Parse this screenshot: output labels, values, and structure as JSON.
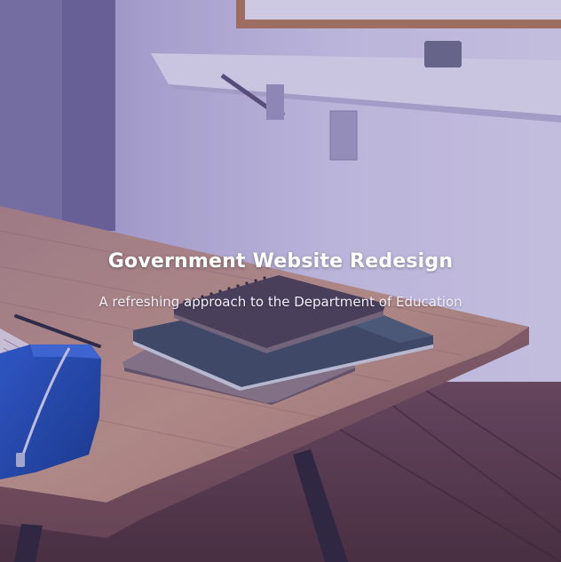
{
  "hero": {
    "title": "Government Website Redesign",
    "subtitle": "A refreshing approach to the Department of Education"
  },
  "colors": {
    "overlay_tint": "#4a3a8c",
    "wall": "#c9c6e4",
    "table_wood": "#b98f7a",
    "floor": "#5a3a38",
    "pencil_case": "#1f4fb0"
  }
}
